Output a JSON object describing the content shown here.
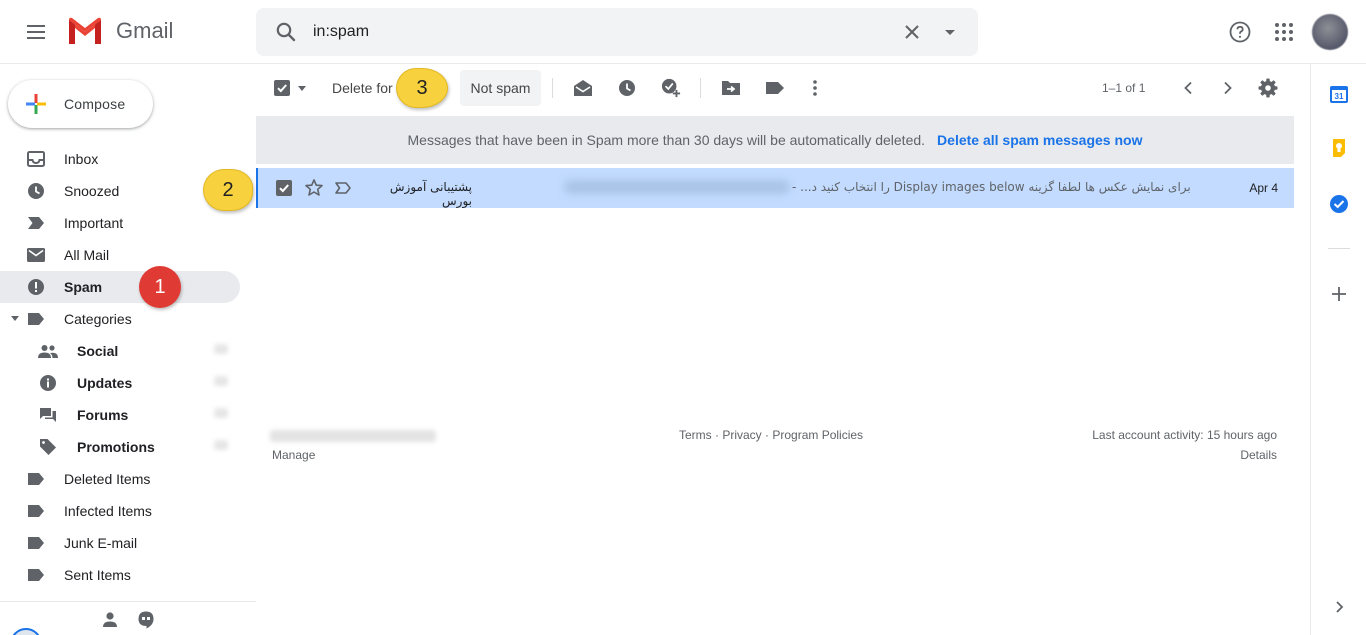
{
  "header": {
    "app_name": "Gmail",
    "search_query": "in:spam"
  },
  "sidebar": {
    "compose_label": "Compose",
    "items": [
      {
        "label": "Inbox",
        "icon": "inbox-icon"
      },
      {
        "label": "Snoozed",
        "icon": "clock-icon"
      },
      {
        "label": "Important",
        "icon": "important-icon"
      },
      {
        "label": "All Mail",
        "icon": "mail-icon"
      },
      {
        "label": "Spam",
        "icon": "spam-icon",
        "active": true
      },
      {
        "label": "Categories",
        "icon": "label-icon"
      },
      {
        "label": "Social",
        "icon": "people-icon"
      },
      {
        "label": "Updates",
        "icon": "info-icon"
      },
      {
        "label": "Forums",
        "icon": "forum-icon"
      },
      {
        "label": "Promotions",
        "icon": "tag-icon"
      },
      {
        "label": "Deleted Items",
        "icon": "label-icon"
      },
      {
        "label": "Infected Items",
        "icon": "label-icon"
      },
      {
        "label": "Junk E-mail",
        "icon": "label-icon"
      },
      {
        "label": "Sent Items",
        "icon": "label-icon"
      }
    ]
  },
  "toolbar": {
    "delete_label": "Delete for",
    "not_spam_label": "Not spam",
    "pagination": "1–1 of 1"
  },
  "banner": {
    "message": "Messages that have been in Spam more than 30 days will be automatically deleted.",
    "link": "Delete all spam messages now"
  },
  "mail": {
    "sender": "پشتیبانی آموزش بورس",
    "snippet": "برای نمایش عکس ها لطفا گزینه Display images below را انتخاب کنید د... -",
    "date": "Apr 4"
  },
  "footer": {
    "manage": "Manage",
    "links": [
      "Terms",
      "Privacy",
      "Program Policies"
    ],
    "activity": "Last account activity: 15 hours ago",
    "details": "Details"
  },
  "callouts": {
    "one": "1",
    "two": "2",
    "three": "3"
  },
  "colors": {
    "accent": "#1a73e8",
    "selected_row": "#c2dbff",
    "callout_yellow": "#f7d23e",
    "callout_red": "#e03a35"
  }
}
